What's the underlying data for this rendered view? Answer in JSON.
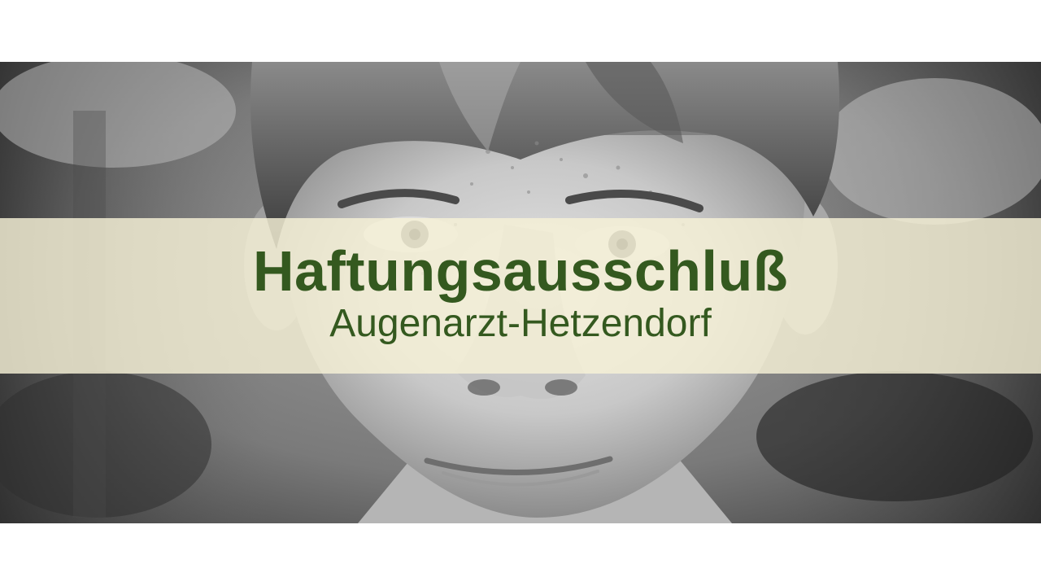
{
  "banner": {
    "title": "Haftungsausschluß",
    "subtitle": "Augenarzt-Hetzendorf"
  },
  "colors": {
    "page_background": "#ffffff",
    "banner_overlay": "#f7f1d7",
    "text_green": "#34591f"
  },
  "image": {
    "subject": "black-and-white-portrait-of-boy-with-freckles"
  }
}
